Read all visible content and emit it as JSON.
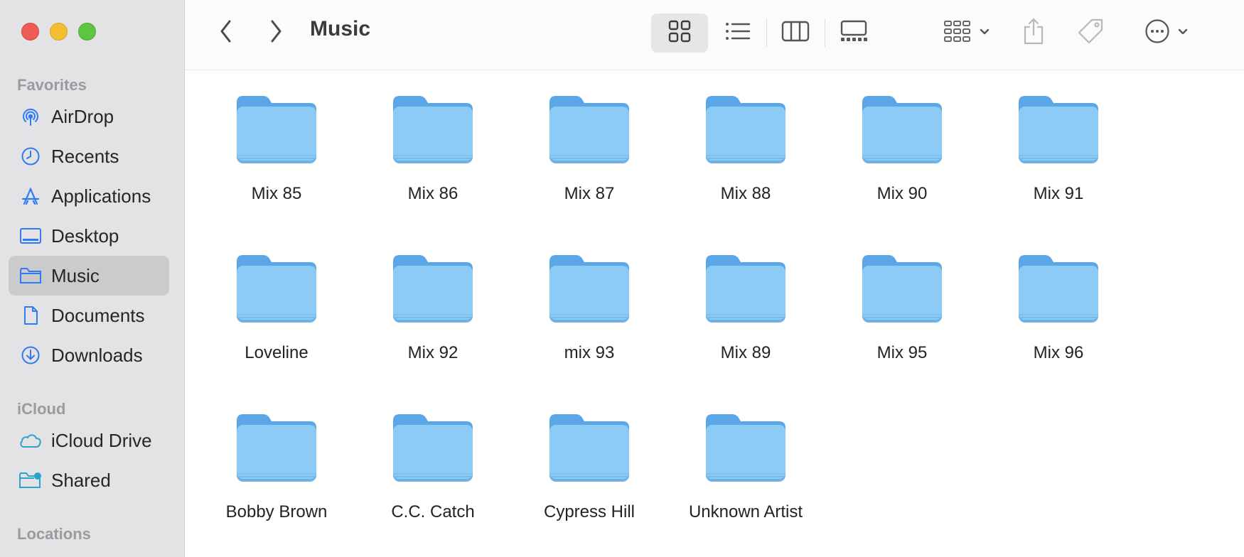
{
  "window": {
    "title": "Music"
  },
  "sidebar": {
    "sections": {
      "favorites": "Favorites",
      "icloud": "iCloud",
      "locations": "Locations"
    },
    "favorites": [
      {
        "label": "AirDrop",
        "icon": "airdrop-icon"
      },
      {
        "label": "Recents",
        "icon": "clock-icon"
      },
      {
        "label": "Applications",
        "icon": "applications-icon"
      },
      {
        "label": "Desktop",
        "icon": "desktop-icon"
      },
      {
        "label": "Music",
        "icon": "folder-icon",
        "selected": true
      },
      {
        "label": "Documents",
        "icon": "document-icon"
      },
      {
        "label": "Downloads",
        "icon": "download-icon"
      }
    ],
    "icloud": [
      {
        "label": "iCloud Drive",
        "icon": "cloud-icon"
      },
      {
        "label": "Shared",
        "icon": "shared-folder-icon"
      }
    ]
  },
  "toolbar": {
    "back_icon": "chevron-left-icon",
    "forward_icon": "chevron-right-icon",
    "views": [
      "icon-view",
      "list-view",
      "column-view",
      "gallery-view"
    ],
    "selected_view": "icon-view",
    "group_icon": "group-by-icon",
    "share_icon": "share-icon",
    "tag_icon": "tag-icon",
    "more_icon": "more-icon"
  },
  "folders": [
    "Mix 85",
    "Mix 86",
    "Mix 87",
    "Mix 88",
    "Mix 90",
    "Mix 91",
    "Loveline",
    "Mix 92",
    "mix 93",
    "Mix 89",
    "Mix 95",
    "Mix 96",
    "Bobby Brown",
    "C.C. Catch",
    "Cypress Hill",
    "Unknown Artist"
  ],
  "colors": {
    "accent": "#2f7bf5",
    "folder_body": "#8ccbf6",
    "folder_tab": "#5aa6e6",
    "sidebar_bg": "#e3e2e4",
    "selected_bg": "#cbcacd"
  }
}
